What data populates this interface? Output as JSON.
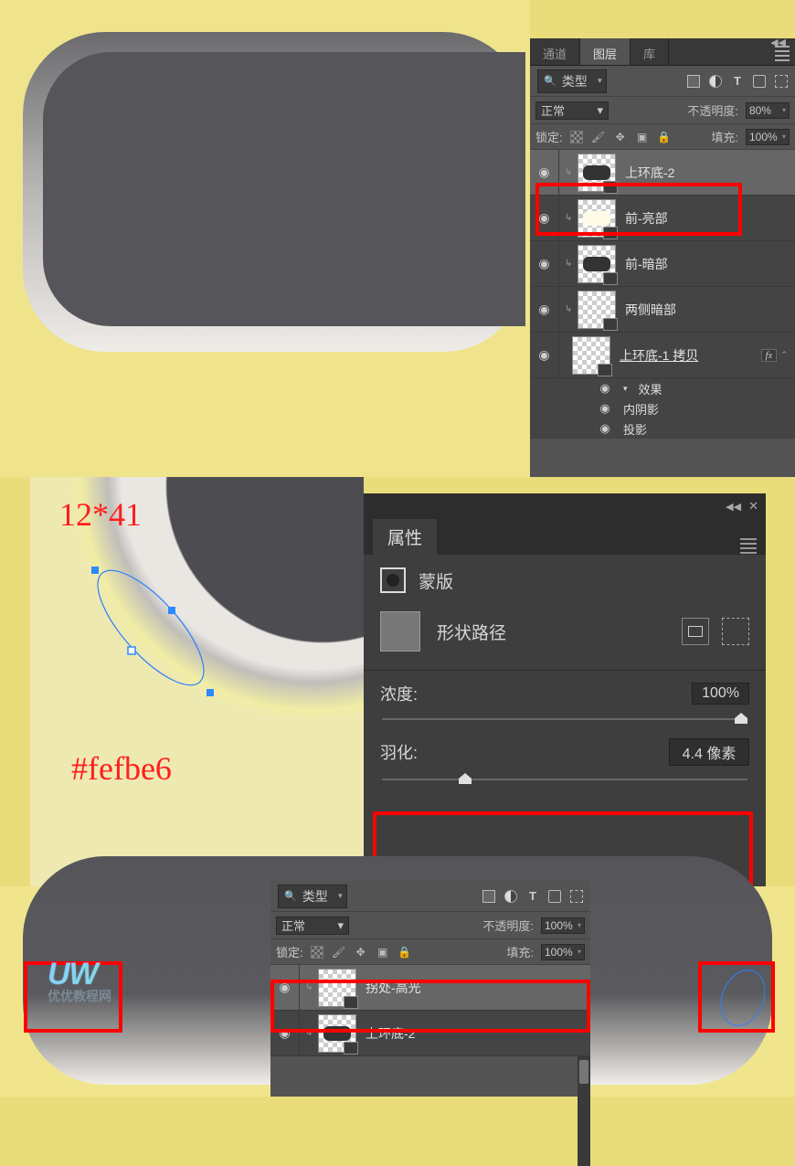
{
  "panel1": {
    "tabs": {
      "channels": "通道",
      "layers": "图层",
      "library": "库"
    },
    "filter_type": "类型",
    "normal": "正常",
    "opacity_label": "不透明度:",
    "opacity_value": "80%",
    "lock_label": "锁定:",
    "fill_label": "填充:",
    "fill_value": "100%",
    "layers": {
      "l0": "上环底-2",
      "l1": "前-亮部",
      "l2": "前-暗部",
      "l3": "两侧暗部",
      "l4": "上环底-1 拷贝"
    },
    "fx": {
      "title": "效果",
      "inner_shadow": "内阴影",
      "drop_shadow": "投影"
    },
    "fx_badge": "fx"
  },
  "annotations": {
    "dims": "12*41",
    "hex": "#fefbe6",
    "logo_line1": "UW",
    "logo_line2": "优优教程网"
  },
  "properties": {
    "title": "属性",
    "mask_title": "蒙版",
    "path_label": "形状路径",
    "density_label": "浓度:",
    "density_value": "100%",
    "feather_label": "羽化:",
    "feather_value": "4.4 像素"
  },
  "panel3": {
    "filter_type": "类型",
    "normal": "正常",
    "opacity_label": "不透明度:",
    "opacity_value": "100%",
    "lock_label": "锁定:",
    "fill_label": "填充:",
    "fill_value": "100%",
    "layers": {
      "l0": "拐处-高光",
      "l1": "上环底-2"
    }
  }
}
